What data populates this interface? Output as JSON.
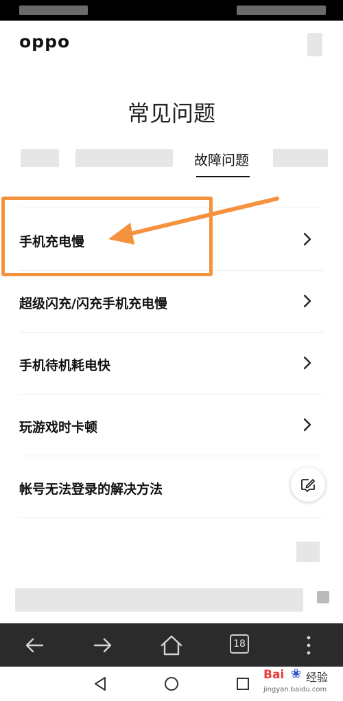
{
  "header": {
    "logo": "oppo"
  },
  "page": {
    "title": "常见问题"
  },
  "tabs": {
    "active_label": "故障问题"
  },
  "faq_items": [
    {
      "label": "手机充电慢"
    },
    {
      "label": "超级闪充/闪充手机充电慢"
    },
    {
      "label": "手机待机耗电快"
    },
    {
      "label": "玩游戏时卡顿"
    },
    {
      "label": "帐号无法登录的解决方法"
    }
  ],
  "browser_nav": {
    "tab_count": "18"
  },
  "watermark": {
    "brand_bai": "Bai",
    "brand_paw": "❀",
    "brand_tail": "经验",
    "url": "jingyan.baidu.com"
  },
  "colors": {
    "highlight": "#f5923e",
    "nav_bg": "#2b2b2b"
  },
  "icons": [
    "back-arrow-icon",
    "forward-arrow-icon",
    "home-icon",
    "tabs-icon",
    "more-icon",
    "chevron-right-icon",
    "edit-feedback-icon",
    "back-triangle-icon",
    "home-circle-icon",
    "recents-square-icon"
  ]
}
